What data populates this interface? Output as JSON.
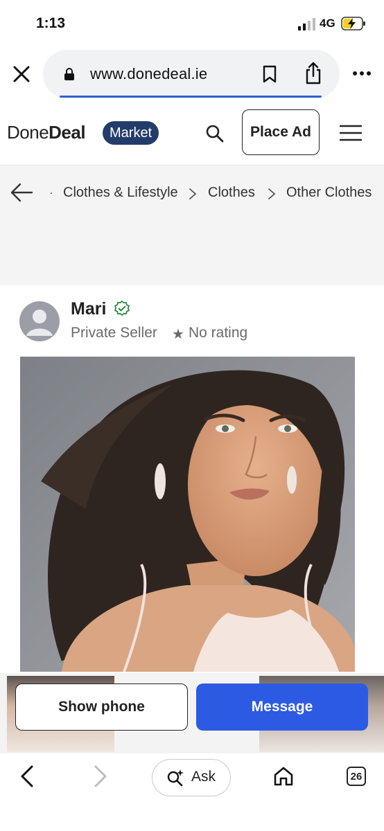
{
  "status_bar": {
    "time": "1:13",
    "network": "4G",
    "battery_icon": "battery-charging-icon"
  },
  "browser": {
    "url": "www.donedeal.ie",
    "icons": [
      "close-icon",
      "lock-icon",
      "bookmark-icon",
      "share-icon",
      "more-icon"
    ]
  },
  "header": {
    "logo_regular": "Done",
    "logo_bold": "Deal",
    "badge": "Market",
    "place_ad": "Place Ad",
    "brand_color": "#233c6a"
  },
  "breadcrumb": [
    "Clothes & Lifestyle",
    "Clothes",
    "Other Clothes"
  ],
  "seller": {
    "name": "Mari",
    "type": "Private Seller",
    "rating_star": "★",
    "rating": "No rating",
    "verified_color": "#2e8b3e"
  },
  "actions": {
    "show_phone": "Show phone",
    "message": "Message",
    "accent": "#2c5ae3"
  },
  "bottom_bar": {
    "ask": "Ask",
    "tab_count": "26"
  }
}
